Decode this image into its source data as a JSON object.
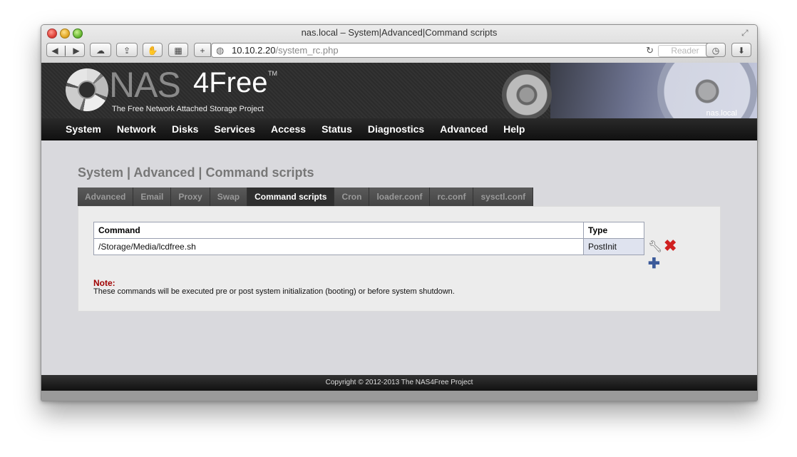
{
  "window": {
    "title": "nas.local – System|Advanced|Command scripts"
  },
  "toolbar": {
    "back_icon": "◀",
    "forward_icon": "▶",
    "icloud_icon": "☁",
    "share_icon": "⇪",
    "privacy_icon": "✋",
    "topsites_icon": "▦",
    "add_icon": "+",
    "reload_icon": "↻",
    "reader_label": "Reader",
    "history_icon": "◷",
    "download_icon": "⬇"
  },
  "url": {
    "host": "10.10.2.20",
    "path": "/system_rc.php"
  },
  "brand": {
    "nas": "NAS",
    "free": "4Free",
    "tm": "TM",
    "tagline": "The Free Network Attached Storage Project",
    "hostname": "nas.local"
  },
  "mainnav": [
    "System",
    "Network",
    "Disks",
    "Services",
    "Access",
    "Status",
    "Diagnostics",
    "Advanced",
    "Help"
  ],
  "page": {
    "title": "System | Advanced | Command scripts"
  },
  "tabs": [
    {
      "label": "Advanced",
      "active": false
    },
    {
      "label": "Email",
      "active": false
    },
    {
      "label": "Proxy",
      "active": false
    },
    {
      "label": "Swap",
      "active": false
    },
    {
      "label": "Command scripts",
      "active": true
    },
    {
      "label": "Cron",
      "active": false
    },
    {
      "label": "loader.conf",
      "active": false
    },
    {
      "label": "rc.conf",
      "active": false
    },
    {
      "label": "sysctl.conf",
      "active": false
    }
  ],
  "table": {
    "headers": {
      "command": "Command",
      "type": "Type"
    },
    "rows": [
      {
        "command": "/Storage/Media/lcdfree.sh",
        "type": "PostInit"
      }
    ]
  },
  "icons": {
    "edit": "wrench-icon",
    "delete": "delete-icon",
    "add": "add-icon"
  },
  "note": {
    "label": "Note:",
    "text": "These commands will be executed pre or post system initialization (booting) or before system shutdown."
  },
  "footer": {
    "copyright": "Copyright © 2012-2013 The NAS4Free Project"
  }
}
